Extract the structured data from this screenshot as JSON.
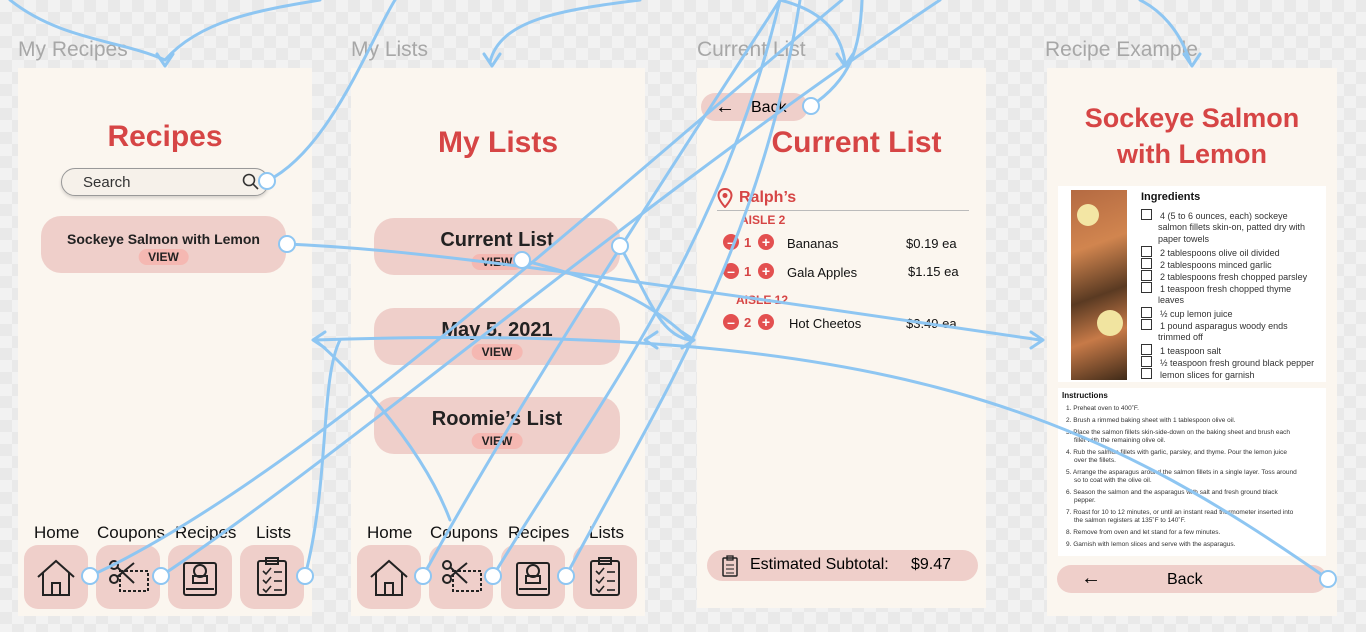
{
  "frame_labels": {
    "recipes": "My Recipes",
    "lists": "My Lists",
    "current": "Current List",
    "example": "Recipe Example"
  },
  "recipes_screen": {
    "title": "Recipes",
    "search_placeholder": "Search",
    "recipe_item": {
      "name": "Sockeye Salmon with Lemon",
      "view": "VIEW"
    }
  },
  "lists_screen": {
    "title": "My Lists",
    "lists": [
      {
        "name": "Current List",
        "view": "VIEW"
      },
      {
        "name": "May 5, 2021",
        "view": "VIEW"
      },
      {
        "name": "Roomie’s List",
        "view": "VIEW"
      }
    ]
  },
  "nav": {
    "home": "Home",
    "coupons": "Coupons",
    "recipes": "Recipes",
    "lists": "Lists"
  },
  "current_screen": {
    "back": "Back",
    "title": "Current List",
    "store": "Ralph’s",
    "aisle_a": "AISLE 2",
    "aisle_b": "AISLE 12",
    "items": [
      {
        "qty": "1",
        "name": "Bananas",
        "price": "$0.19 ea"
      },
      {
        "qty": "1",
        "name": "Gala Apples",
        "price": "$1.15 ea"
      },
      {
        "qty": "2",
        "name": "Hot Cheetos",
        "price": "$3.49 ea"
      }
    ],
    "subtotal_label": "Estimated Subtotal:",
    "subtotal_value": "$9.47"
  },
  "example_screen": {
    "title_line1": "Sockeye Salmon",
    "title_line2": "with Lemon",
    "ingredients_heading": "Ingredients",
    "ingredients": [
      "4 (5 to 6 ounces, each) sockeye",
      "2 tablespoons olive oil divided",
      "2 tablespoons minced garlic",
      "2 tablespoons fresh chopped parsley",
      "1 teaspoon fresh chopped thyme",
      "½ cup lemon juice",
      "1 pound asparagus woody ends",
      "1 teaspoon salt",
      "½ teaspoon fresh ground black pepper",
      "lemon slices for garnish"
    ],
    "ingredient_cont": [
      "salmon fillets skin-on, patted dry with",
      "paper towels",
      "leaves",
      "trimmed off"
    ],
    "instructions_heading": "Instructions",
    "instructions": [
      "1. Preheat oven to 400˚F.",
      "2. Brush a rimmed baking sheet with 1 tablespoon olive oil.",
      "3. Place the salmon fillets skin-side-down on the baking sheet and brush each",
      "fillet with the remaining olive oil.",
      "4. Rub the salmon fillets with garlic, parsley, and thyme. Pour the lemon juice",
      "over the fillets.",
      "5. Arrange the asparagus around the salmon fillets in a single layer. Toss around",
      "so to coat with the olive oil.",
      "6. Season the salmon and the asparagus with salt and fresh ground black",
      "pepper.",
      "7. Roast for 10 to 12 minutes, or until an instant read thermometer inserted into",
      "the salmon registers at 135˚F to 140˚F.",
      "8. Remove from oven and let stand for a few minutes.",
      "9. Garnish with lemon slices and serve with the asparagus."
    ],
    "back": "Back"
  },
  "colors": {
    "accent": "#d64545",
    "pill": "#efcfca",
    "frame": "#fbf6ef",
    "connector": "#8ec6f2"
  }
}
